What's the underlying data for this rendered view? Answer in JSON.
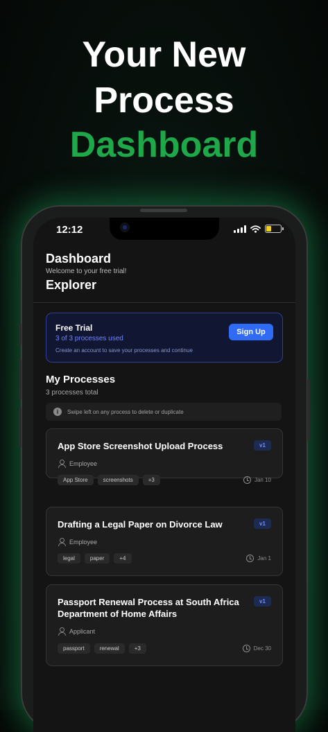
{
  "hero": {
    "line1": "Your New",
    "line2": "Process",
    "line3": "Dashboard"
  },
  "status_bar": {
    "time": "12:12"
  },
  "header": {
    "title": "Dashboard",
    "subtitle": "Welcome to your free trial!",
    "title2": "Explorer"
  },
  "trial": {
    "title": "Free Trial",
    "used": "3 of 3 processes used",
    "note": "Create an account to save your processes and continue",
    "signup_label": "Sign Up"
  },
  "processes": {
    "title": "My Processes",
    "count": "3 processes total",
    "hint": "Swipe left on any process to delete or duplicate",
    "items": [
      {
        "title": "App Store Screenshot Upload Process",
        "version": "v1",
        "role": "Employee",
        "tags": [
          "App Store",
          "screenshots",
          "+3"
        ],
        "date": "Jan 10"
      },
      {
        "title": "Drafting a Legal Paper on Divorce Law",
        "version": "v1",
        "role": "Employee",
        "tags": [
          "legal",
          "paper",
          "+4"
        ],
        "date": "Jan 1"
      },
      {
        "title": "Passport Renewal Process at South Africa Department of Home Affairs",
        "version": "v1",
        "role": "Applicant",
        "tags": [
          "passport",
          "renewal",
          "+3"
        ],
        "date": "Dec 30"
      }
    ]
  },
  "colors": {
    "accent_green": "#1fa84a",
    "accent_blue": "#2f6bf4",
    "battery_yellow": "#f3d21f"
  },
  "battery_level": 0.35
}
